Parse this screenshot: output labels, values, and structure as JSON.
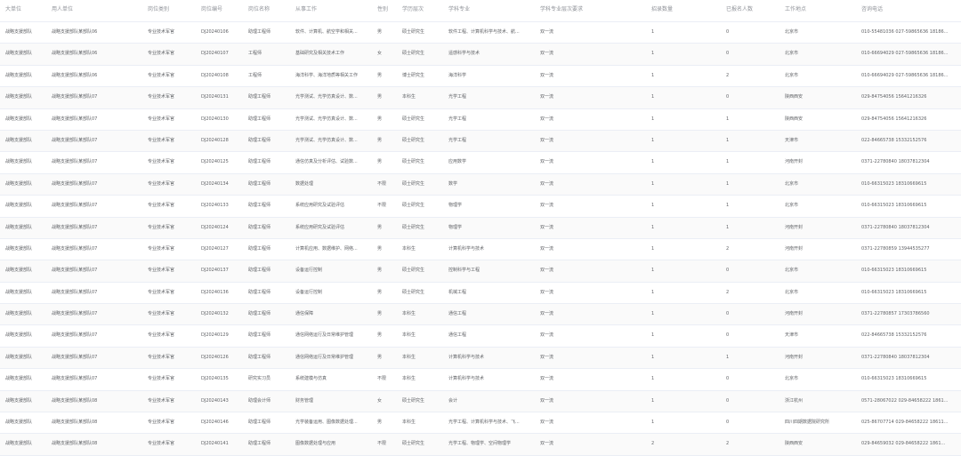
{
  "columns": [
    "大单位",
    "用人单位",
    "岗位类别",
    "岗位编号",
    "岗位名称",
    "从事工作",
    "性别",
    "学历层次",
    "学科专业",
    "学科专业层次要求",
    "招录数量",
    "已报名人数",
    "工作地点",
    "咨询电话"
  ],
  "rows": [
    [
      "战略支援部队",
      "战略支援部队某部队06",
      "专业技术军官",
      "DJ20240106",
      "助理工程师",
      "软件、计算机、航空学和相关...",
      "男",
      "硕士研究生",
      "软件工程、计算机科学与技术、航...",
      "双一流",
      "1",
      "0",
      "北京市",
      "010-55481036 027-59865636 18186..."
    ],
    [
      "战略支援部队",
      "战略支援部队某部队06",
      "专业技术军官",
      "DJ20240107",
      "工程师",
      "基础研究及相关技术工作",
      "女",
      "硕士研究生",
      "遥感科学与技术",
      "双一流",
      "1",
      "0",
      "北京市",
      "010-66694029 027-59865636 18186..."
    ],
    [
      "战略支援部队",
      "战略支援部队某部队06",
      "专业技术军官",
      "DJ20240108",
      "工程师",
      "海洋科学、海洋地质等相关工作",
      "男",
      "博士研究生",
      "海洋科学",
      "双一流",
      "1",
      "2",
      "北京市",
      "010-66694029 027-59865636 18186..."
    ],
    [
      "战略支援部队",
      "战略支援部队某部队07",
      "专业技术军官",
      "DJ20240131",
      "助理工程师",
      "光学测试、光学仿真设计、数...",
      "男",
      "本科生",
      "光学工程",
      "双一流",
      "1",
      "0",
      "陕西西安",
      "029-84754056 15641216326"
    ],
    [
      "战略支援部队",
      "战略支援部队某部队07",
      "专业技术军官",
      "DJ20240130",
      "助理工程师",
      "光学测试、光学仿真设计、数...",
      "男",
      "硕士研究生",
      "光学工程",
      "双一流",
      "1",
      "1",
      "陕西西安",
      "029-84754056 15641216326"
    ],
    [
      "战略支援部队",
      "战略支援部队某部队07",
      "专业技术军官",
      "DJ20240128",
      "助理工程师",
      "光学测试、光学仿真设计、数...",
      "男",
      "硕士研究生",
      "光学工程",
      "双一流",
      "1",
      "1",
      "天津市",
      "022-84665738 15332152576"
    ],
    [
      "战略支援部队",
      "战略支援部队某部队07",
      "专业技术军官",
      "DJ20240125",
      "助理工程师",
      "通信仿真及分析评估、试验数...",
      "男",
      "硕士研究生",
      "应用数学",
      "双一流",
      "1",
      "1",
      "河南开封",
      "0371-22780840 18037812304"
    ],
    [
      "战略支援部队",
      "战略支援部队某部队07",
      "专业技术军官",
      "DJ20240134",
      "助理工程师",
      "数据处理",
      "不限",
      "硕士研究生",
      "数学",
      "双一流",
      "1",
      "1",
      "北京市",
      "010-66315023 18310669615"
    ],
    [
      "战略支援部队",
      "战略支援部队某部队07",
      "专业技术军官",
      "DJ20240133",
      "助理工程师",
      "系统应用研究及试验评估",
      "不限",
      "硕士研究生",
      "物理学",
      "双一流",
      "1",
      "1",
      "北京市",
      "010-66315023 18310669615"
    ],
    [
      "战略支援部队",
      "战略支援部队某部队07",
      "专业技术军官",
      "DJ20240124",
      "助理工程师",
      "系统应用研究及试验评估",
      "男",
      "硕士研究生",
      "物理学",
      "双一流",
      "1",
      "1",
      "河南开封",
      "0371-22780840 18037812304"
    ],
    [
      "战略支援部队",
      "战略支援部队某部队07",
      "专业技术军官",
      "DJ20240127",
      "助理工程师",
      "计算机应用、数据维护、网络...",
      "男",
      "本科生",
      "计算机科学与技术",
      "双一流",
      "1",
      "2",
      "河南开封",
      "0371-22780859 13944535277"
    ],
    [
      "战略支援部队",
      "战略支援部队某部队07",
      "专业技术军官",
      "DJ20240137",
      "助理工程师",
      "设备运行控制",
      "男",
      "硕士研究生",
      "控制科学与工程",
      "双一流",
      "1",
      "0",
      "北京市",
      "010-66315023 18310669615"
    ],
    [
      "战略支援部队",
      "战略支援部队某部队07",
      "专业技术军官",
      "DJ20240136",
      "助理工程师",
      "设备运行控制",
      "男",
      "硕士研究生",
      "机械工程",
      "双一流",
      "1",
      "2",
      "北京市",
      "010-66315023 18310669615"
    ],
    [
      "战略支援部队",
      "战略支援部队某部队07",
      "专业技术军官",
      "DJ20240132",
      "助理工程师",
      "通信保障",
      "男",
      "本科生",
      "通信工程",
      "双一流",
      "1",
      "0",
      "河南开封",
      "0371-22780857 17303786560"
    ],
    [
      "战略支援部队",
      "战略支援部队某部队07",
      "专业技术军官",
      "DJ20240129",
      "助理工程师",
      "通信网络运行及日常维护管理",
      "男",
      "本科生",
      "通信工程",
      "双一流",
      "1",
      "0",
      "天津市",
      "022-84665738 15332152576"
    ],
    [
      "战略支援部队",
      "战略支援部队某部队07",
      "专业技术军官",
      "DJ20240126",
      "助理工程师",
      "通信网络运行及日常维护管理",
      "男",
      "本科生",
      "计算机科学与技术",
      "双一流",
      "1",
      "1",
      "河南开封",
      "0371-22780840 18037812304"
    ],
    [
      "战略支援部队",
      "战略支援部队某部队07",
      "专业技术军官",
      "DJ20240135",
      "研究实习员",
      "系统建模与仿真",
      "不限",
      "本科生",
      "计算机科学与技术",
      "双一流",
      "1",
      "0",
      "北京市",
      "010-66315023 18310669615"
    ],
    [
      "战略支援部队",
      "战略支援部队某部队08",
      "专业技术军官",
      "DJ20240143",
      "助理会计师",
      "财务管理",
      "女",
      "硕士研究生",
      "会计",
      "双一流",
      "1",
      "0",
      "浙江杭州",
      "0571-28067022 029-84658222 1861..."
    ],
    [
      "战略支援部队",
      "战略支援部队某部队08",
      "专业技术军官",
      "DJ20240146",
      "助理工程师",
      "光学装备运用、图像数据处理...",
      "男",
      "本科生",
      "光学工程、计算机科学与技术、飞...",
      "双一流",
      "1",
      "0",
      "四川四期数据院研究所",
      "025-86707714 029-84658222 18611..."
    ],
    [
      "战略支援部队",
      "战略支援部队某部队08",
      "专业技术军官",
      "DJ20240141",
      "助理工程师",
      "图像数据处理与应用",
      "不限",
      "硕士研究生",
      "光学工程、物理学、空间物理学",
      "双一流",
      "2",
      "2",
      "陕西西安",
      "029-84659032 029-84658222 1861..."
    ]
  ]
}
